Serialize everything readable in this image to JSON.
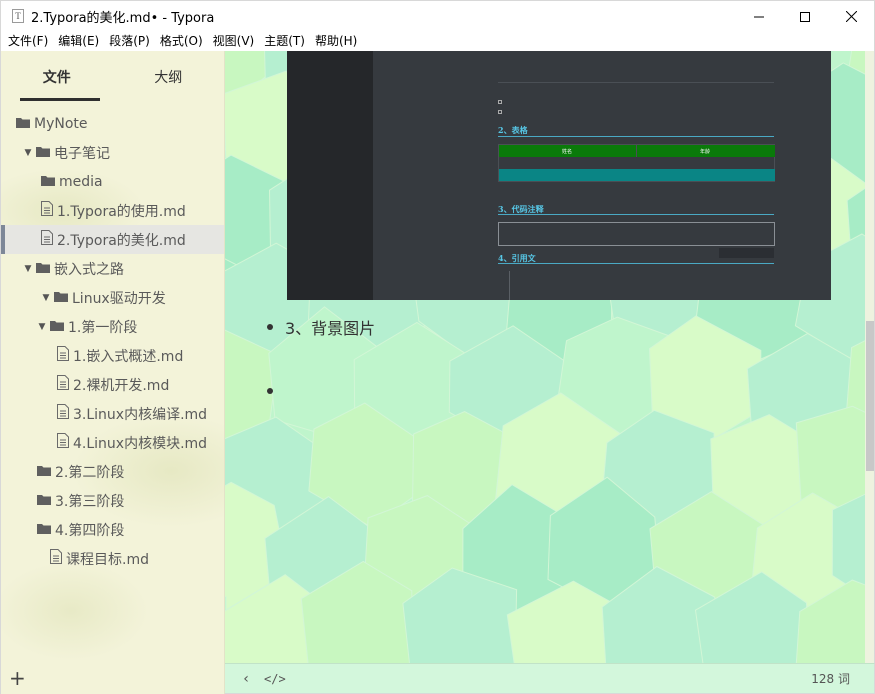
{
  "window": {
    "title": "2.Typora的美化.md• - Typora",
    "app_icon": "typora-doc-icon",
    "controls": [
      "minimize",
      "maximize",
      "close"
    ]
  },
  "menu": [
    "文件(F)",
    "编辑(E)",
    "段落(P)",
    "格式(O)",
    "视图(V)",
    "主题(T)",
    "帮助(H)"
  ],
  "sidebar": {
    "tabs": [
      {
        "label": "文件",
        "active": true
      },
      {
        "label": "大纲",
        "active": false
      }
    ],
    "tree": [
      {
        "label": "MyNote",
        "type": "folder",
        "level": 0,
        "toggle": ""
      },
      {
        "label": "电子笔记",
        "type": "folder",
        "level": 1,
        "toggle": "▼"
      },
      {
        "label": "media",
        "type": "folder",
        "level": 2,
        "toggle": ""
      },
      {
        "label": "1.Typora的使用.md",
        "type": "file",
        "level": 2,
        "toggle": ""
      },
      {
        "label": "2.Typora的美化.md",
        "type": "file",
        "level": 2,
        "toggle": "",
        "active": true
      },
      {
        "label": "嵌入式之路",
        "type": "folder",
        "level": 1,
        "toggle": "▼"
      },
      {
        "label": "Linux驱动开发",
        "type": "folder",
        "level": 2,
        "toggle": "▼"
      },
      {
        "label": "1.第一阶段",
        "type": "folder",
        "level": 3,
        "toggle": "▼"
      },
      {
        "label": "1.嵌入式概述.md",
        "type": "file",
        "level": 4,
        "toggle": ""
      },
      {
        "label": "2.裸机开发.md",
        "type": "file",
        "level": 4,
        "toggle": ""
      },
      {
        "label": "3.Linux内核编译.md",
        "type": "file",
        "level": 4,
        "toggle": ""
      },
      {
        "label": "4.Linux内核模块.md",
        "type": "file",
        "level": 4,
        "toggle": ""
      },
      {
        "label": "2.第二阶段",
        "type": "folder",
        "level": 3,
        "toggle": ""
      },
      {
        "label": "3.第三阶段",
        "type": "folder",
        "level": 3,
        "toggle": ""
      },
      {
        "label": "4.第四阶段",
        "type": "folder",
        "level": 3,
        "toggle": ""
      },
      {
        "label": "课程目标.md",
        "type": "file",
        "level": 3,
        "toggle": ""
      }
    ],
    "add_label": "+"
  },
  "editor": {
    "embedded_screenshot": {
      "headings": [
        "2、表格",
        "3、代码注释",
        "4、引用文"
      ],
      "table_headers": [
        "姓名",
        "年龄"
      ]
    },
    "list_items": [
      "3、背景图片",
      ""
    ]
  },
  "status": {
    "back_label": "‹",
    "source_label": "</>",
    "word_count": "128 词"
  },
  "colors": {
    "sidebar_bg": "#f3f3d9",
    "editor_bg_light": "#d8fbc8",
    "editor_bg_mid": "#bff5cc",
    "editor_bg_dark": "#a7ecc6",
    "active_file_bg": "#e6e6e2",
    "active_marker": "#7d8797"
  }
}
